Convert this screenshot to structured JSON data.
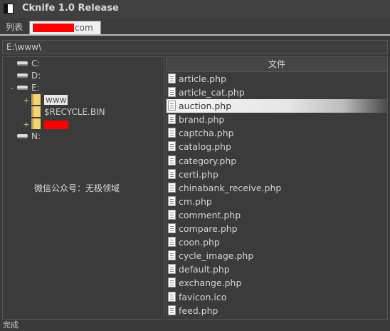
{
  "window": {
    "title": "Cknife 1.0 Release"
  },
  "tabs": [
    {
      "label": "列表"
    },
    {
      "label": "com"
    }
  ],
  "path_bar": {
    "value": "E:\\www\\"
  },
  "tree": {
    "drives": [
      {
        "label": "C:",
        "expander": ""
      },
      {
        "label": "D:",
        "expander": ""
      },
      {
        "label": "E:",
        "expander": "-"
      },
      {
        "label": "N:",
        "expander": ""
      }
    ],
    "e_children": [
      {
        "label": "www",
        "expander": "+"
      },
      {
        "label": "$RECYCLE.BIN",
        "expander": ""
      },
      {
        "label": "",
        "expander": "+"
      }
    ]
  },
  "watermark_text": "微信公众号：无极领域",
  "files": {
    "column_header": "文件",
    "selected": "auction.php",
    "items": [
      "article.php",
      "article_cat.php",
      "auction.php",
      "brand.php",
      "captcha.php",
      "catalog.php",
      "category.php",
      "certi.php",
      "chinabank_receive.php",
      "cm.php",
      "comment.php",
      "compare.php",
      "coon.php",
      "cycle_image.php",
      "default.php",
      "exchange.php",
      "favicon.ico",
      "feed.php"
    ]
  },
  "status_bar": {
    "text": "完成"
  },
  "colors": {
    "redaction": "#ff0000",
    "selection": "#e6e6e6"
  }
}
